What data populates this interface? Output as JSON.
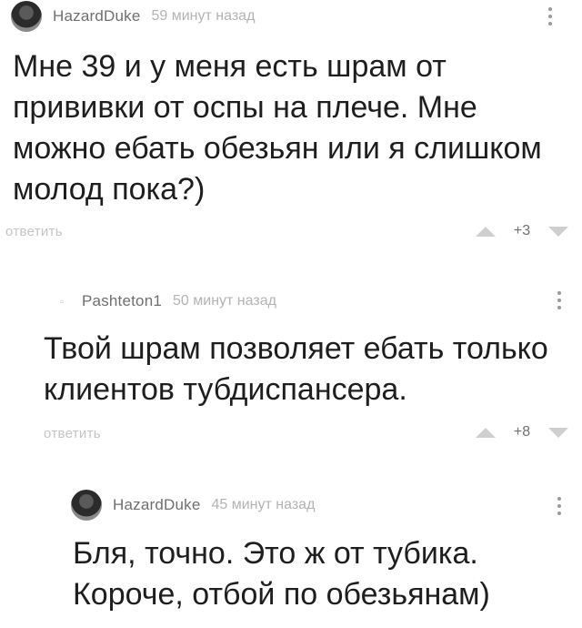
{
  "comments": [
    {
      "username": "HazardDuke",
      "time": "59 минут назад",
      "text": "Мне 39 и у меня есть шрам от прививки от оспы на плече. Мне можно ебать обезьян или я слишком молод пока?)",
      "reply_label": "ответить",
      "score": "+3",
      "avatar_icon": "user-avatar-photo"
    },
    {
      "username": "Pashteton1",
      "time": "50 минут назад",
      "text": "Твой шрам позволяет ебать только клиентов тубдиспансера.",
      "reply_label": "ответить",
      "score": "+8",
      "avatar_icon": "user-avatar-small"
    },
    {
      "username": "HazardDuke",
      "time": "45 минут назад",
      "text": "Бля, точно. Это ж от тубика. Короче, отбой по обезьянам)",
      "avatar_icon": "user-avatar-photo"
    }
  ]
}
